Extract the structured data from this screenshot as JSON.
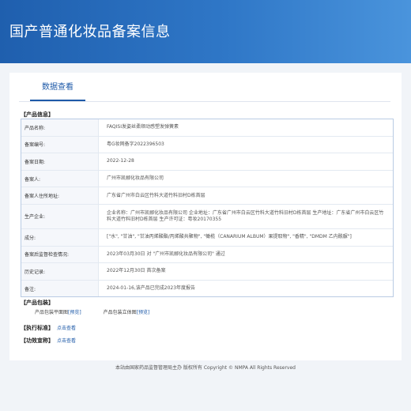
{
  "banner": {
    "title": "国产普通化妆品备案信息"
  },
  "tabs": [
    {
      "label": "数据查看"
    }
  ],
  "product_info": {
    "section_title": "【产品信息】",
    "rows": [
      {
        "label": "产品名称:",
        "value": "FAQISI发姿丝柔顺动感塑发弹簧素"
      },
      {
        "label": "备案编号:",
        "value": "粤G妆网备字2022396503"
      },
      {
        "label": "备案日期:",
        "value": "2022-12-28"
      },
      {
        "label": "备案人:",
        "value": "广州市凯郦化妆品有限公司"
      },
      {
        "label": "备案人住所地址:",
        "value": "广东省广州市白云区竹料大道竹料旧村D栋首层"
      },
      {
        "label": "生产企业:",
        "value": "企业名称：广州市凯郦化妆品有限公司 企业地址：广东省广州市白云区竹料大道竹料旧村D栋首层 生产地址：广东省广州市白云区竹料大道竹料旧村D栋首层 生产许可证：粤妆20170355"
      },
      {
        "label": "成分:",
        "value": "[\"水\", \"甘油\", \"甘油丙烯酸酯/丙烯酸共聚物\", \"橄榄（CANARIUM ALBUM）果提取物\", \"香精\", \"DMDM 乙内酰脲\"]"
      },
      {
        "label": "备案后监督检查情况:",
        "value": "2023年03月30日 对 \"广州市凯郦化妆品有限公司\" 通过"
      },
      {
        "label": "历史记录:",
        "value": "2022年12月30日 首次备案"
      },
      {
        "label": "备注:",
        "value": "2024-01-16,该产品已完成2023年度报告"
      }
    ]
  },
  "packaging": {
    "section_title": "【产品包装】",
    "flat_label": "产品包装平面图",
    "stereo_label": "产品包装立体图",
    "preview_label": "[预览]"
  },
  "standard": {
    "label": "【执行标准】",
    "link": "点击查看"
  },
  "efficacy": {
    "label": "【功效宣称】",
    "link": "点击查看"
  },
  "footer": {
    "text": "本站由国家药品监督管理局主办 版权所有 Copyright © NMPA All Rights Reserved"
  }
}
